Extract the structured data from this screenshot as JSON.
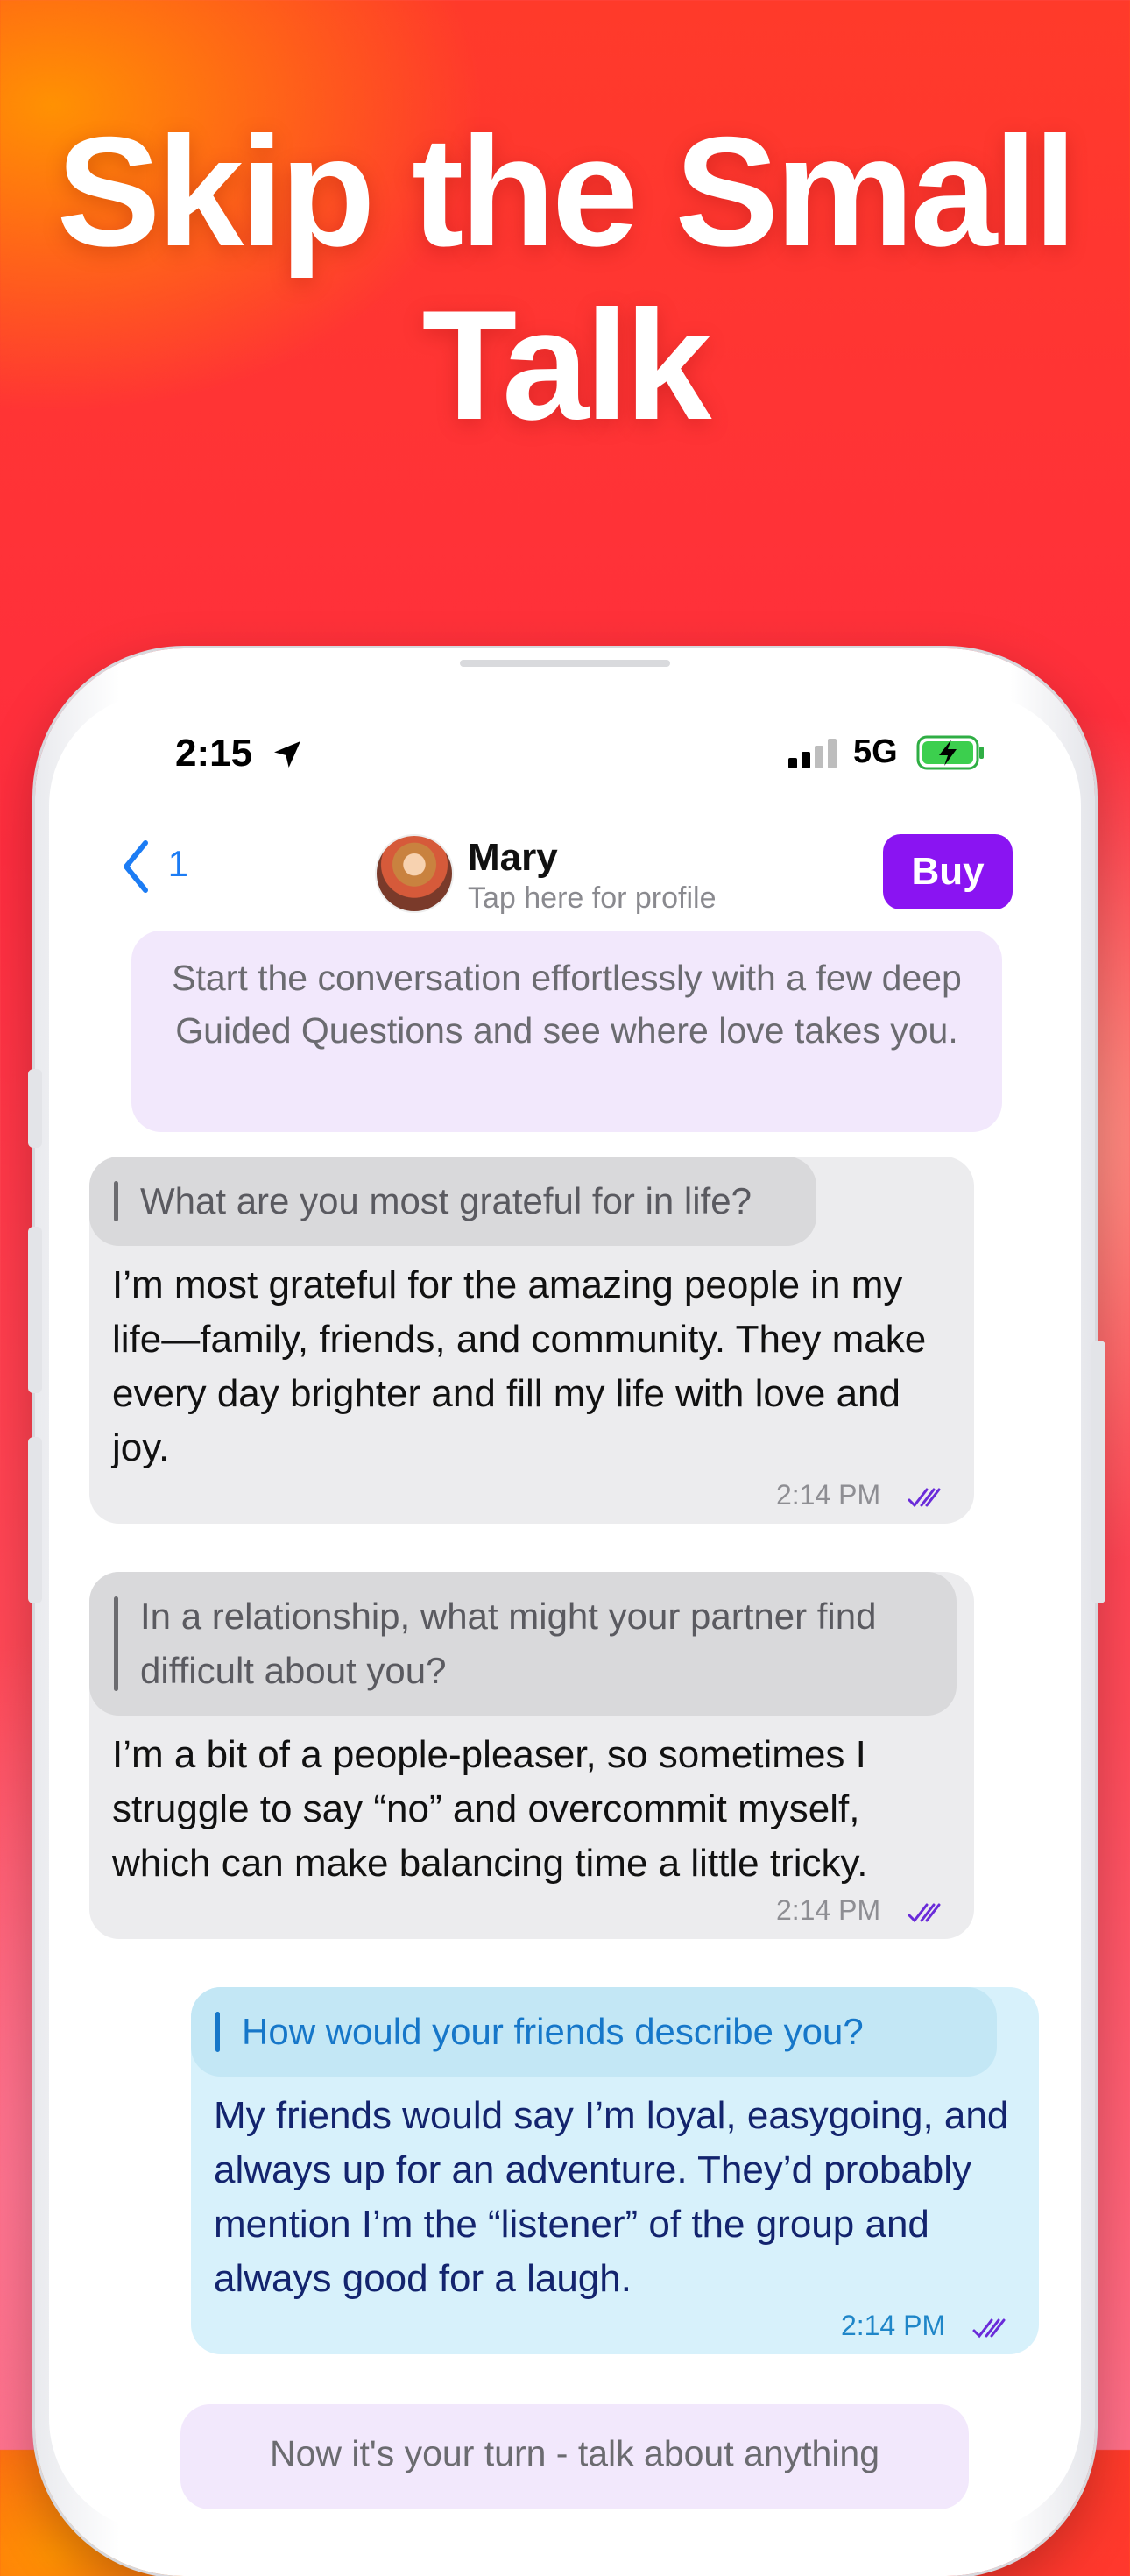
{
  "headline": "Skip the Small Talk",
  "status_bar": {
    "time": "2:15",
    "network": "5G"
  },
  "header": {
    "back_count": "1",
    "contact_name": "Mary",
    "contact_subtitle": "Tap here for profile",
    "buy_label": "Buy"
  },
  "intro_text": "Start the conversation effortlessly with a few deep Guided Questions and see where love takes you.",
  "messages": [
    {
      "question": "What are you most grateful for in life?",
      "answer": "I’m most grateful for the amazing people in my life—family, friends, and community. They make every day brighter and fill my life with love and joy.",
      "time": "2:14 PM"
    },
    {
      "question": "In a relationship, what might your partner find difficult about you?",
      "answer": "I’m a bit of a people-pleaser, so sometimes I struggle to say “no” and overcommit myself, which can make balancing time a little tricky.",
      "time": "2:14 PM"
    },
    {
      "question": "How would your friends describe you?",
      "answer": "My friends would say I’m loyal, easygoing, and always up for an adventure. They’d probably mention I’m the “listener” of the group and always good for a laugh.",
      "time": "2:14 PM"
    }
  ],
  "next_prompt": "Now it's your turn - talk about anything",
  "colors": {
    "accent": "#8a14f2",
    "link": "#1c7cf4",
    "intro_bg": "#f2e8fc",
    "sent_bg": "#d7f1fb",
    "received_bg": "#ececee"
  }
}
